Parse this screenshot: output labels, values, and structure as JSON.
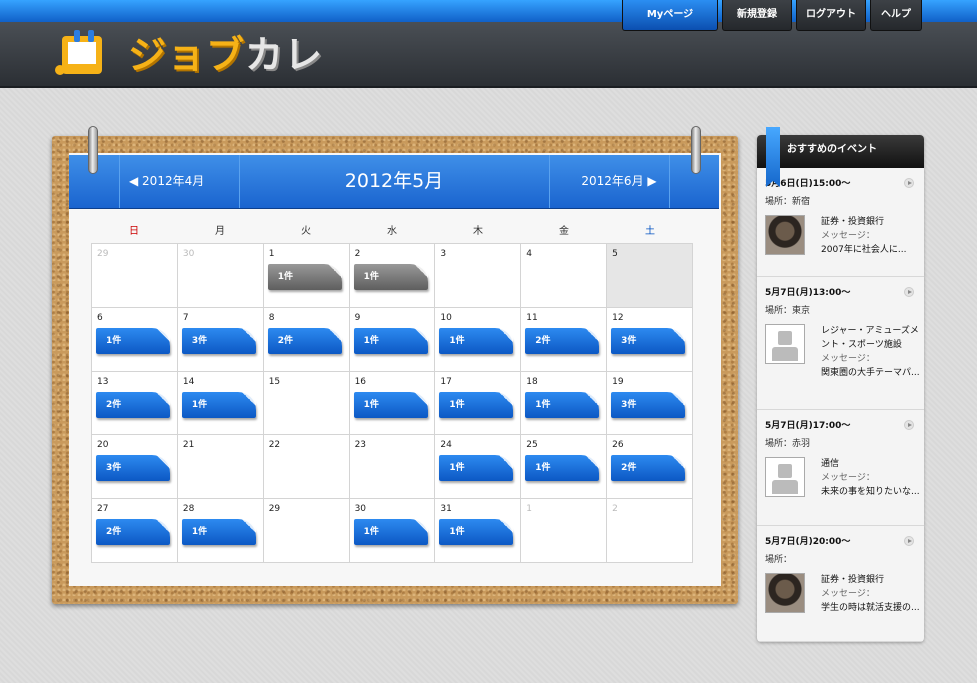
{
  "header": {
    "logo_text_a": "ジョブ",
    "logo_text_b": "カレ",
    "nav": [
      {
        "label": "Myページ",
        "active": true
      },
      {
        "label": "新規登録",
        "active": false
      },
      {
        "label": "ログアウト",
        "active": false
      },
      {
        "label": "ヘルプ",
        "active": false
      }
    ]
  },
  "calendar": {
    "prev_label": "◀ 2012年4月",
    "next_label": "2012年6月 ▶",
    "title": "2012年5月",
    "weekdays": [
      "日",
      "月",
      "火",
      "水",
      "木",
      "金",
      "土"
    ],
    "weeks": [
      [
        {
          "day": "29",
          "other": true
        },
        {
          "day": "30",
          "other": true
        },
        {
          "day": "1",
          "count": "1件",
          "gray": true
        },
        {
          "day": "2",
          "count": "1件",
          "gray": true
        },
        {
          "day": "3"
        },
        {
          "day": "4"
        },
        {
          "day": "5",
          "today": true
        }
      ],
      [
        {
          "day": "6",
          "count": "1件"
        },
        {
          "day": "7",
          "count": "3件"
        },
        {
          "day": "8",
          "count": "2件"
        },
        {
          "day": "9",
          "count": "1件"
        },
        {
          "day": "10",
          "count": "1件"
        },
        {
          "day": "11",
          "count": "2件"
        },
        {
          "day": "12",
          "count": "3件"
        }
      ],
      [
        {
          "day": "13",
          "count": "2件"
        },
        {
          "day": "14",
          "count": "1件"
        },
        {
          "day": "15"
        },
        {
          "day": "16",
          "count": "1件"
        },
        {
          "day": "17",
          "count": "1件"
        },
        {
          "day": "18",
          "count": "1件"
        },
        {
          "day": "19",
          "count": "3件"
        }
      ],
      [
        {
          "day": "20",
          "count": "3件"
        },
        {
          "day": "21"
        },
        {
          "day": "22"
        },
        {
          "day": "23"
        },
        {
          "day": "24",
          "count": "1件"
        },
        {
          "day": "25",
          "count": "1件"
        },
        {
          "day": "26",
          "count": "2件"
        }
      ],
      [
        {
          "day": "27",
          "count": "2件"
        },
        {
          "day": "28",
          "count": "1件"
        },
        {
          "day": "29"
        },
        {
          "day": "30",
          "count": "1件"
        },
        {
          "day": "31",
          "count": "1件"
        },
        {
          "day": "1",
          "other": true
        },
        {
          "day": "2",
          "other": true
        }
      ]
    ]
  },
  "sidebar": {
    "title": "おすすめのイベント",
    "events": [
      {
        "when": "5月6日(日)15:00〜",
        "place": "場所：新宿",
        "company": "証券・投資銀行",
        "msg_label": "メッセージ：",
        "msg": "2007年に社会人に...",
        "avatar": "photo"
      },
      {
        "when": "5月7日(月)13:00〜",
        "place": "場所：東京",
        "company": "レジャー・アミューズメント・スポーツ施設",
        "msg_label": "メッセージ：",
        "msg": "関東圏の大手テーマパ...",
        "avatar": "blank"
      },
      {
        "when": "5月7日(月)17:00〜",
        "place": "場所：赤羽",
        "company": "通信",
        "msg_label": "メッセージ：",
        "msg": "未来の事を知りたいな...",
        "avatar": "blank"
      },
      {
        "when": "5月7日(月)20:00〜",
        "place": "場所：",
        "company": "証券・投資銀行",
        "msg_label": "メッセージ：",
        "msg": "学生の時は就活支援の...",
        "avatar": "photo"
      }
    ]
  }
}
